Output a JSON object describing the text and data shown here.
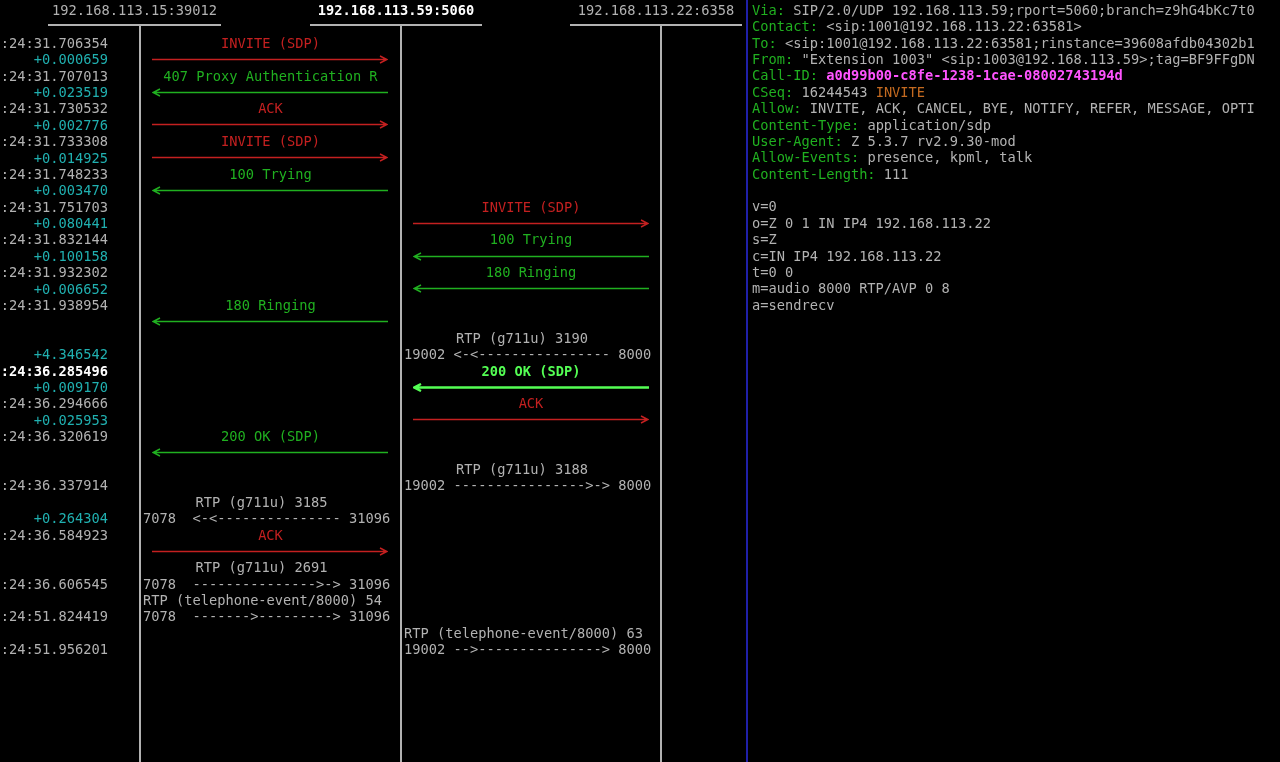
{
  "participants": [
    {
      "address": "192.168.113.15:39012",
      "selected": false
    },
    {
      "address": "192.168.113.59:5060",
      "selected": true
    },
    {
      "address": "192.168.113.22:6358",
      "selected": false
    }
  ],
  "rows": [
    {
      "time": {
        "kind": "timestamp",
        "text": ":24:31.706354",
        "selected": false
      },
      "cells": [
        {
          "kind": "label",
          "color": "#c42020",
          "text": "INVITE (SDP)",
          "selected": false
        },
        {
          "kind": "empty"
        }
      ]
    },
    {
      "time": {
        "kind": "delta",
        "text": "+0.000659",
        "selected": false
      },
      "cells": [
        {
          "kind": "right_arrow",
          "color": "#c42020",
          "selected": false
        },
        {
          "kind": "empty"
        }
      ]
    },
    {
      "time": {
        "kind": "timestamp",
        "text": ":24:31.707013",
        "selected": false
      },
      "cells": [
        {
          "kind": "label",
          "color": "#20b020",
          "text": "407 Proxy Authentication R",
          "selected": false
        },
        {
          "kind": "empty"
        }
      ]
    },
    {
      "time": {
        "kind": "delta",
        "text": "+0.023519",
        "selected": false
      },
      "cells": [
        {
          "kind": "left_arrow",
          "color": "#20b020",
          "selected": false
        },
        {
          "kind": "empty"
        }
      ]
    },
    {
      "time": {
        "kind": "timestamp",
        "text": ":24:31.730532",
        "selected": false
      },
      "cells": [
        {
          "kind": "label",
          "color": "#c42020",
          "text": "ACK",
          "selected": false
        },
        {
          "kind": "empty"
        }
      ]
    },
    {
      "time": {
        "kind": "delta",
        "text": "+0.002776",
        "selected": false
      },
      "cells": [
        {
          "kind": "right_arrow",
          "color": "#c42020",
          "selected": false
        },
        {
          "kind": "empty"
        }
      ]
    },
    {
      "time": {
        "kind": "timestamp",
        "text": ":24:31.733308",
        "selected": false
      },
      "cells": [
        {
          "kind": "label",
          "color": "#c42020",
          "text": "INVITE (SDP)",
          "selected": false
        },
        {
          "kind": "empty"
        }
      ]
    },
    {
      "time": {
        "kind": "delta",
        "text": "+0.014925",
        "selected": false
      },
      "cells": [
        {
          "kind": "right_arrow",
          "color": "#c42020",
          "selected": false
        },
        {
          "kind": "empty"
        }
      ]
    },
    {
      "time": {
        "kind": "timestamp",
        "text": ":24:31.748233",
        "selected": false
      },
      "cells": [
        {
          "kind": "label",
          "color": "#20b020",
          "text": "100 Trying",
          "selected": false
        },
        {
          "kind": "empty"
        }
      ]
    },
    {
      "time": {
        "kind": "delta",
        "text": "+0.003470",
        "selected": false
      },
      "cells": [
        {
          "kind": "left_arrow",
          "color": "#20b020",
          "selected": false
        },
        {
          "kind": "empty"
        }
      ]
    },
    {
      "time": {
        "kind": "timestamp",
        "text": ":24:31.751703",
        "selected": false
      },
      "cells": [
        {
          "kind": "empty"
        },
        {
          "kind": "label",
          "color": "#c42020",
          "text": "INVITE (SDP)",
          "selected": false
        }
      ]
    },
    {
      "time": {
        "kind": "delta",
        "text": "+0.080441",
        "selected": false
      },
      "cells": [
        {
          "kind": "empty"
        },
        {
          "kind": "right_arrow",
          "color": "#c42020",
          "selected": false
        }
      ]
    },
    {
      "time": {
        "kind": "timestamp",
        "text": ":24:31.832144",
        "selected": false
      },
      "cells": [
        {
          "kind": "empty"
        },
        {
          "kind": "label",
          "color": "#20b020",
          "text": "100 Trying",
          "selected": false
        }
      ]
    },
    {
      "time": {
        "kind": "delta",
        "text": "+0.100158",
        "selected": false
      },
      "cells": [
        {
          "kind": "empty"
        },
        {
          "kind": "left_arrow",
          "color": "#20b020",
          "selected": false
        }
      ]
    },
    {
      "time": {
        "kind": "timestamp",
        "text": ":24:31.932302",
        "selected": false
      },
      "cells": [
        {
          "kind": "empty"
        },
        {
          "kind": "label",
          "color": "#20b020",
          "text": "180 Ringing",
          "selected": false
        }
      ]
    },
    {
      "time": {
        "kind": "delta",
        "text": "+0.006652",
        "selected": false
      },
      "cells": [
        {
          "kind": "empty"
        },
        {
          "kind": "left_arrow",
          "color": "#20b020",
          "selected": false
        }
      ]
    },
    {
      "time": {
        "kind": "timestamp",
        "text": ":24:31.938954",
        "selected": false
      },
      "cells": [
        {
          "kind": "label",
          "color": "#20b020",
          "text": "180 Ringing",
          "selected": false
        },
        {
          "kind": "empty"
        }
      ]
    },
    {
      "cells": [
        {
          "kind": "left_arrow",
          "color": "#20b020",
          "selected": false
        },
        {
          "kind": "empty"
        }
      ]
    },
    {
      "cells": [
        {
          "kind": "empty"
        },
        {
          "kind": "rtp_label",
          "text": "RTP (g711u) 3190"
        }
      ]
    },
    {
      "time": {
        "kind": "delta",
        "text": "+4.346542",
        "selected": false
      },
      "cells": [
        {
          "kind": "empty"
        },
        {
          "kind": "stream",
          "text": "19002 <-<---------------- 8000"
        }
      ]
    },
    {
      "time": {
        "kind": "timestamp",
        "text": ":24:36.285496",
        "selected": true
      },
      "cells": [
        {
          "kind": "empty"
        },
        {
          "kind": "label",
          "color": "#54ff54",
          "text": "200 OK (SDP)",
          "selected": true
        }
      ]
    },
    {
      "time": {
        "kind": "delta",
        "text": "+0.009170",
        "selected": false
      },
      "cells": [
        {
          "kind": "empty"
        },
        {
          "kind": "left_arrow",
          "color": "#54ff54",
          "selected": true
        }
      ]
    },
    {
      "time": {
        "kind": "timestamp",
        "text": ":24:36.294666",
        "selected": false
      },
      "cells": [
        {
          "kind": "empty"
        },
        {
          "kind": "label",
          "color": "#c42020",
          "text": "ACK",
          "selected": false
        }
      ]
    },
    {
      "time": {
        "kind": "delta",
        "text": "+0.025953",
        "selected": false
      },
      "cells": [
        {
          "kind": "empty"
        },
        {
          "kind": "right_arrow",
          "color": "#c42020",
          "selected": false
        }
      ]
    },
    {
      "time": {
        "kind": "timestamp",
        "text": ":24:36.320619",
        "selected": false
      },
      "cells": [
        {
          "kind": "label",
          "color": "#20b020",
          "text": "200 OK (SDP)",
          "selected": false
        },
        {
          "kind": "empty"
        }
      ]
    },
    {
      "cells": [
        {
          "kind": "left_arrow",
          "color": "#20b020",
          "selected": false
        },
        {
          "kind": "empty"
        }
      ]
    },
    {
      "cells": [
        {
          "kind": "empty"
        },
        {
          "kind": "rtp_label",
          "text": "RTP (g711u) 3188"
        }
      ]
    },
    {
      "time": {
        "kind": "timestamp",
        "text": ":24:36.337914",
        "selected": false
      },
      "cells": [
        {
          "kind": "empty"
        },
        {
          "kind": "stream",
          "text": "19002 ---------------->-> 8000"
        }
      ]
    },
    {
      "cells": [
        {
          "kind": "rtp_label",
          "text": "RTP (g711u) 3185"
        },
        {
          "kind": "empty"
        }
      ]
    },
    {
      "time": {
        "kind": "delta",
        "text": "+0.264304",
        "selected": false
      },
      "cells": [
        {
          "kind": "stream",
          "text": "7078  <-<--------------- 31096"
        },
        {
          "kind": "empty"
        }
      ]
    },
    {
      "time": {
        "kind": "timestamp",
        "text": ":24:36.584923",
        "selected": false
      },
      "cells": [
        {
          "kind": "label",
          "color": "#c42020",
          "text": "ACK",
          "selected": false
        },
        {
          "kind": "empty"
        }
      ]
    },
    {
      "cells": [
        {
          "kind": "right_arrow",
          "color": "#c42020",
          "selected": false
        },
        {
          "kind": "empty"
        }
      ]
    },
    {
      "cells": [
        {
          "kind": "rtp_label",
          "text": "RTP (g711u) 2691"
        },
        {
          "kind": "empty"
        }
      ]
    },
    {
      "time": {
        "kind": "timestamp",
        "text": ":24:36.606545",
        "selected": false
      },
      "cells": [
        {
          "kind": "stream",
          "text": "7078  --------------->-> 31096"
        },
        {
          "kind": "empty"
        }
      ]
    },
    {
      "cells": [
        {
          "kind": "stream_label",
          "text": "RTP (telephone-event/8000) 54"
        },
        {
          "kind": "empty"
        }
      ]
    },
    {
      "time": {
        "kind": "timestamp",
        "text": ":24:51.824419",
        "selected": false
      },
      "cells": [
        {
          "kind": "stream",
          "text": "7078  ------->---------> 31096"
        },
        {
          "kind": "empty"
        }
      ]
    },
    {
      "cells": [
        {
          "kind": "empty"
        },
        {
          "kind": "stream_label",
          "text": "RTP (telephone-event/8000) 63"
        }
      ]
    },
    {
      "time": {
        "kind": "timestamp",
        "text": ":24:51.956201",
        "selected": false
      },
      "cells": [
        {
          "kind": "empty"
        },
        {
          "kind": "stream",
          "text": "19002 -->---------------> 8000"
        }
      ]
    }
  ],
  "message": {
    "headers": [
      {
        "kind": "plain",
        "name": "Via:",
        "value": "SIP/2.0/UDP 192.168.113.59;rport=5060;branch=z9hG4bKc7t0"
      },
      {
        "kind": "plain",
        "name": "Contact:",
        "value": "<sip:1001@192.168.113.22:63581>"
      },
      {
        "kind": "plain",
        "name": "To:",
        "value": "<sip:1001@192.168.113.22:63581;rinstance=39608afdb04302b1"
      },
      {
        "kind": "plain",
        "name": "From:",
        "value": "\"Extension 1003\" <sip:1003@192.168.113.59>;tag=BF9FFgDN"
      },
      {
        "kind": "call_id",
        "name": "Call-ID:",
        "value": "a0d99b00-c8fe-1238-1cae-08002743194d"
      },
      {
        "kind": "cseq",
        "name": "CSeq:",
        "value": "16244543",
        "method": "INVITE"
      },
      {
        "kind": "plain",
        "name": "Allow:",
        "value": "INVITE, ACK, CANCEL, BYE, NOTIFY, REFER, MESSAGE, OPTI"
      },
      {
        "kind": "plain",
        "name": "Content-Type:",
        "value": "application/sdp"
      },
      {
        "kind": "plain",
        "name": "User-Agent:",
        "value": "Z 5.3.7 rv2.9.30-mod"
      },
      {
        "kind": "plain",
        "name": "Allow-Events:",
        "value": "presence, kpml, talk"
      },
      {
        "kind": "plain",
        "name": "Content-Length:",
        "value": "111"
      }
    ],
    "body": [
      "v=0",
      "o=Z 0 1 IN IP4 192.168.113.22",
      "s=Z",
      "c=IN IP4 192.168.113.22",
      "t=0 0",
      "m=audio 8000 RTP/AVP 0 8",
      "a=sendrecv"
    ]
  }
}
